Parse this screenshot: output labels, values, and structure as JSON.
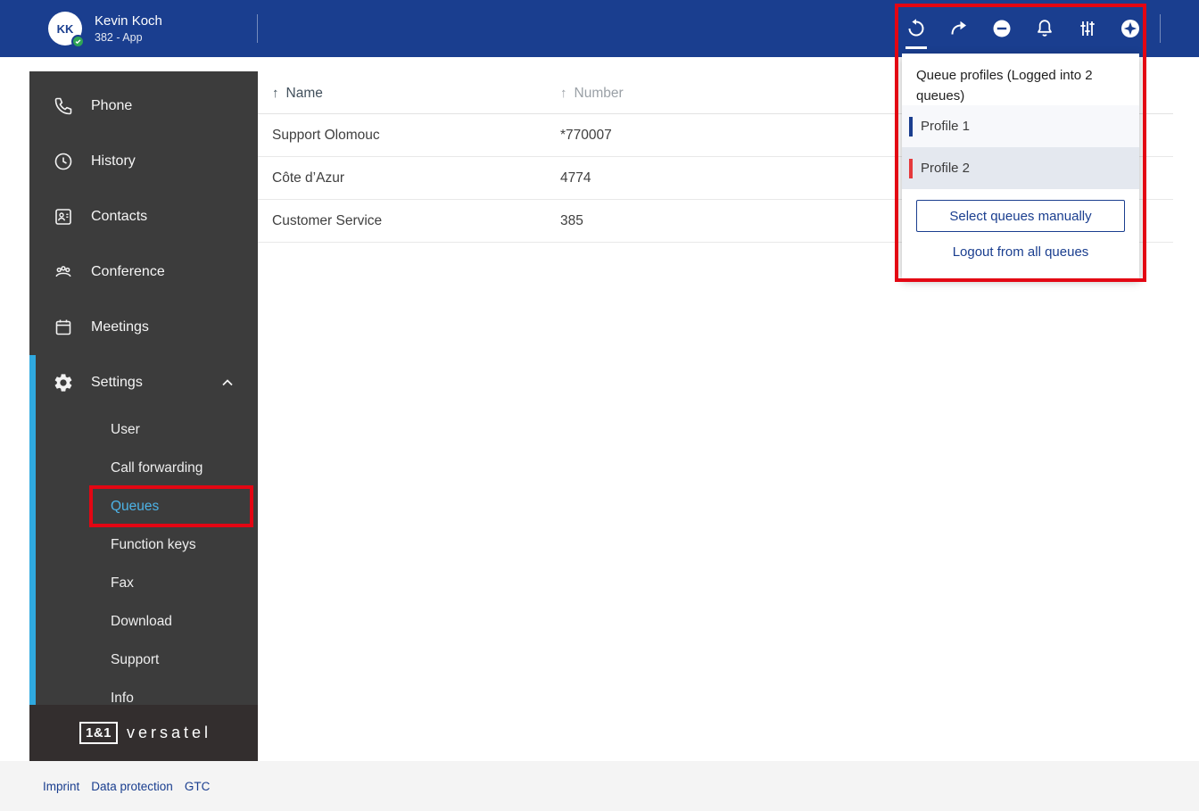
{
  "header": {
    "user": {
      "initials": "KK",
      "name": "Kevin Koch",
      "subtitle": "382 - App",
      "status": "online"
    },
    "actions": [
      {
        "name": "queue-profiles",
        "active": true
      },
      {
        "name": "call-redirect",
        "active": false
      },
      {
        "name": "do-not-disturb",
        "active": false
      },
      {
        "name": "notifications",
        "active": false
      },
      {
        "name": "audio-settings",
        "active": false
      },
      {
        "name": "assistant",
        "active": false
      }
    ]
  },
  "sidebar": {
    "items": [
      {
        "label": "Phone",
        "icon": "phone-icon"
      },
      {
        "label": "History",
        "icon": "history-icon"
      },
      {
        "label": "Contacts",
        "icon": "contacts-icon"
      },
      {
        "label": "Conference",
        "icon": "conference-icon"
      },
      {
        "label": "Meetings",
        "icon": "meetings-icon"
      },
      {
        "label": "Settings",
        "icon": "settings-icon",
        "expanded": true
      }
    ],
    "subitems": [
      {
        "label": "User",
        "selected": false
      },
      {
        "label": "Call forwarding",
        "selected": false
      },
      {
        "label": "Queues",
        "selected": true
      },
      {
        "label": "Function keys",
        "selected": false
      },
      {
        "label": "Fax",
        "selected": false
      },
      {
        "label": "Download",
        "selected": false
      },
      {
        "label": "Support",
        "selected": false
      },
      {
        "label": "Info",
        "selected": false
      }
    ],
    "logo": {
      "box": "1&1",
      "brand": "versatel"
    }
  },
  "table": {
    "columns": [
      {
        "label": "Name",
        "sort": "↑"
      },
      {
        "label": "Number",
        "sort": "↑"
      }
    ],
    "rows": [
      {
        "name": "Support Olomouc",
        "number": "*770007"
      },
      {
        "name": "Côte d’Azur",
        "number": "4774"
      },
      {
        "name": "Customer Service",
        "number": "385"
      }
    ]
  },
  "queue_popup": {
    "title": "Queue profiles (Logged into 2 queues)",
    "profiles": [
      {
        "label": "Profile 1",
        "bar_color": "#1a3e8f",
        "selected": false
      },
      {
        "label": "Profile 2",
        "bar_color": "#e5393c",
        "selected": true
      }
    ],
    "select_button": "Select queues manually",
    "logout_button": "Logout from all queues"
  },
  "footer": {
    "links": [
      "Imprint",
      "Data protection",
      "GTC"
    ]
  },
  "colors": {
    "brand_blue": "#1a3e8f",
    "annotation_red": "#e30613",
    "selected_subitem_blue": "#4db3e6",
    "sidebar_bg": "#3c3c3c",
    "accent_strip_blue": "#2fa9e0",
    "footer_bg": "#f4f4f4"
  }
}
